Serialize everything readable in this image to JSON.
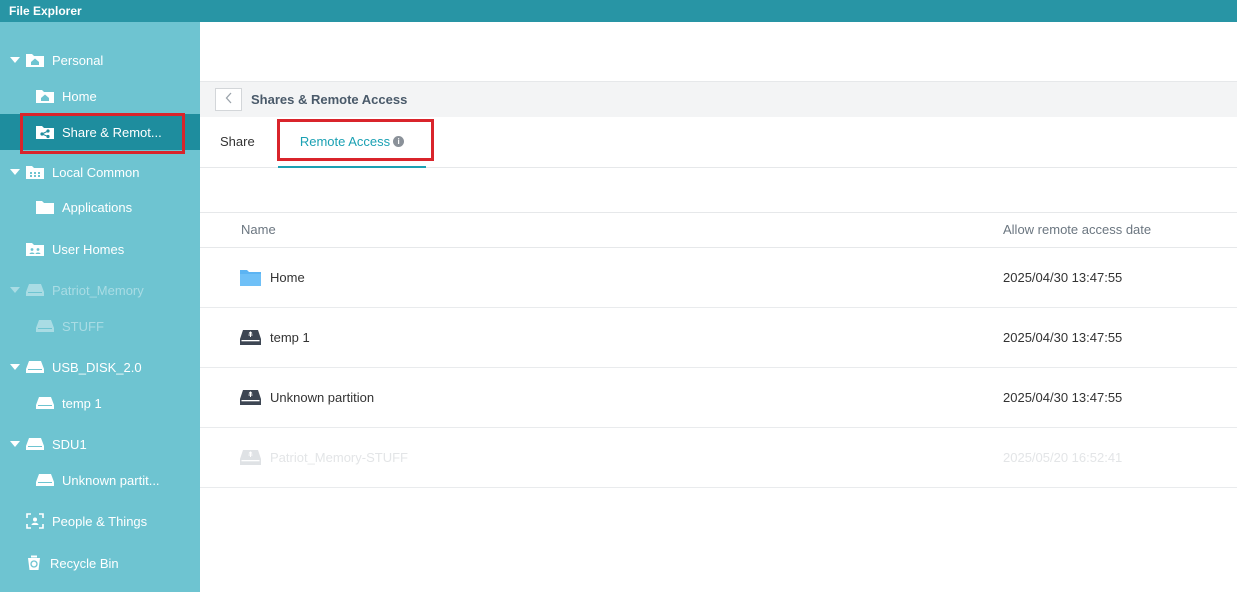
{
  "window": {
    "title": "File Explorer"
  },
  "sidebar": {
    "items": [
      {
        "label": "Personal",
        "icon": "home-folder-icon"
      },
      {
        "label": "Home",
        "icon": "home-folder-icon"
      },
      {
        "label": "Share & Remot...",
        "icon": "shared-folder-icon",
        "selected": true
      },
      {
        "label": "Local Common",
        "icon": "grid-folder-icon"
      },
      {
        "label": "Applications",
        "icon": "folder-icon"
      },
      {
        "label": "User Homes",
        "icon": "users-folder-icon"
      },
      {
        "label": "Patriot_Memory",
        "icon": "usb-drive-icon",
        "disabled": true
      },
      {
        "label": "STUFF",
        "icon": "usb-drive-icon",
        "disabled": true
      },
      {
        "label": "USB_DISK_2.0",
        "icon": "usb-drive-icon"
      },
      {
        "label": "temp 1",
        "icon": "usb-drive-icon"
      },
      {
        "label": "SDU1",
        "icon": "usb-drive-icon"
      },
      {
        "label": "Unknown partit...",
        "icon": "usb-drive-icon"
      },
      {
        "label": "People & Things",
        "icon": "face-scan-icon"
      },
      {
        "label": "Recycle Bin",
        "icon": "recycle-bin-icon"
      }
    ]
  },
  "header": {
    "title": "Shares & Remote Access"
  },
  "tabs": [
    {
      "label": "Share",
      "active": false
    },
    {
      "label": "Remote Access",
      "active": true,
      "info": "i"
    }
  ],
  "table": {
    "columns": [
      "Name",
      "Allow remote access date"
    ],
    "rows": [
      {
        "name": "Home",
        "date": "2025/04/30 13:47:55",
        "icon": "folder-icon"
      },
      {
        "name": "temp 1",
        "date": "2025/04/30 13:47:55",
        "icon": "usb-drive-icon"
      },
      {
        "name": "Unknown partition",
        "date": "2025/04/30 13:47:55",
        "icon": "usb-drive-icon"
      },
      {
        "name": "Patriot_Memory-STUFF",
        "date": "2025/05/20 16:52:41",
        "icon": "usb-drive-icon",
        "faded": true
      }
    ]
  },
  "colors": {
    "titlebar": "#2895a5",
    "sidebar": "#6ec4d1",
    "sidebar_selected": "#1e8d9e",
    "accent": "#1ba1b3",
    "highlight_box": "#d9242b"
  }
}
